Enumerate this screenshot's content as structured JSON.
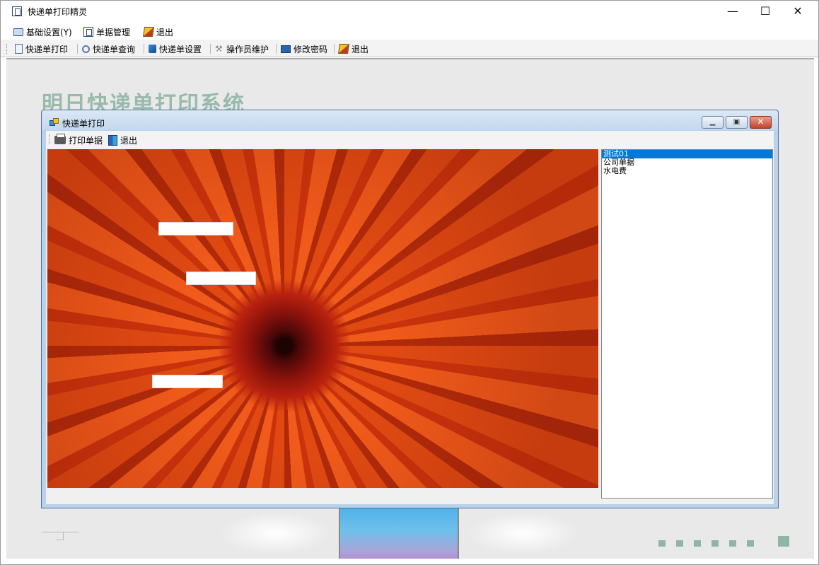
{
  "window": {
    "title": "快递单打印精灵",
    "minimize": "—",
    "maximize": "☐",
    "close": "✕"
  },
  "menubar": {
    "items": [
      {
        "label": "基础设置(Y)",
        "icon": "monitor-icon"
      },
      {
        "label": "单据管理",
        "icon": "document-frame-icon"
      },
      {
        "label": "退出",
        "icon": "exit-icon"
      }
    ]
  },
  "toolbar": {
    "items": [
      {
        "label": "快递单打印",
        "icon": "print-doc-icon"
      },
      {
        "label": "快递单查询",
        "icon": "search-icon"
      },
      {
        "label": "快递单设置",
        "icon": "cube-settings-icon"
      },
      {
        "label": "操作员维护",
        "icon": "tools-icon"
      },
      {
        "label": "修改密码",
        "icon": "password-icon"
      },
      {
        "label": "退出",
        "icon": "exit-icon"
      }
    ]
  },
  "background": {
    "title": "明日快递单打印系统",
    "accent_color": "#8fb5a5"
  },
  "child": {
    "title": "快递单打印",
    "minimize": "▁",
    "restore": "▣",
    "close": "✕",
    "toolbar": {
      "print_label": "打印单据",
      "exit_label": "退出"
    },
    "listbox": {
      "items": [
        "测试01",
        "公司单据",
        "水电费"
      ],
      "selected_index": 0
    }
  }
}
